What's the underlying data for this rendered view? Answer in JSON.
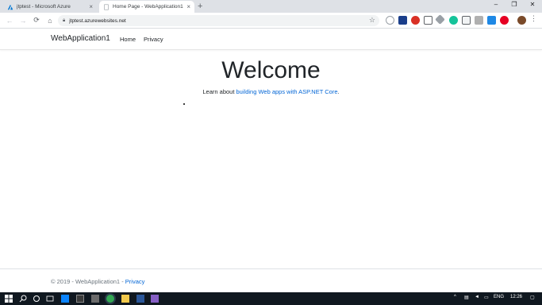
{
  "browser": {
    "tabs": [
      {
        "title": "jtptest - Microsoft Azure",
        "active": false
      },
      {
        "title": "Home Page - WebApplication1",
        "active": true
      }
    ],
    "new_tab": "+",
    "window_controls": {
      "minimize": "–",
      "maximize": "❐",
      "close": "✕"
    },
    "url": "jtptest.azurewebsites.net",
    "colors": {
      "tab_strip": "#dee1e6",
      "omnibox": "#f1f3f4"
    }
  },
  "site": {
    "brand": "WebApplication1",
    "nav": [
      "Home",
      "Privacy"
    ],
    "heading": "Welcome",
    "learn_prefix": "Learn about ",
    "learn_link": "building Web apps with ASP.NET Core",
    "learn_suffix": ".",
    "footer_text": "© 2019 - WebApplication1 - ",
    "footer_link": "Privacy",
    "link_color": "#0366d6"
  },
  "taskbar": {
    "language": "ENG",
    "time": "12:26",
    "icons": [
      "windows-start-icon",
      "search-icon",
      "task-view-icon",
      "edge-icon",
      "file-explorer-icon",
      "store-icon",
      "mail-icon",
      "chrome-icon",
      "folder-icon",
      "word-icon",
      "visual-studio-icon"
    ]
  }
}
